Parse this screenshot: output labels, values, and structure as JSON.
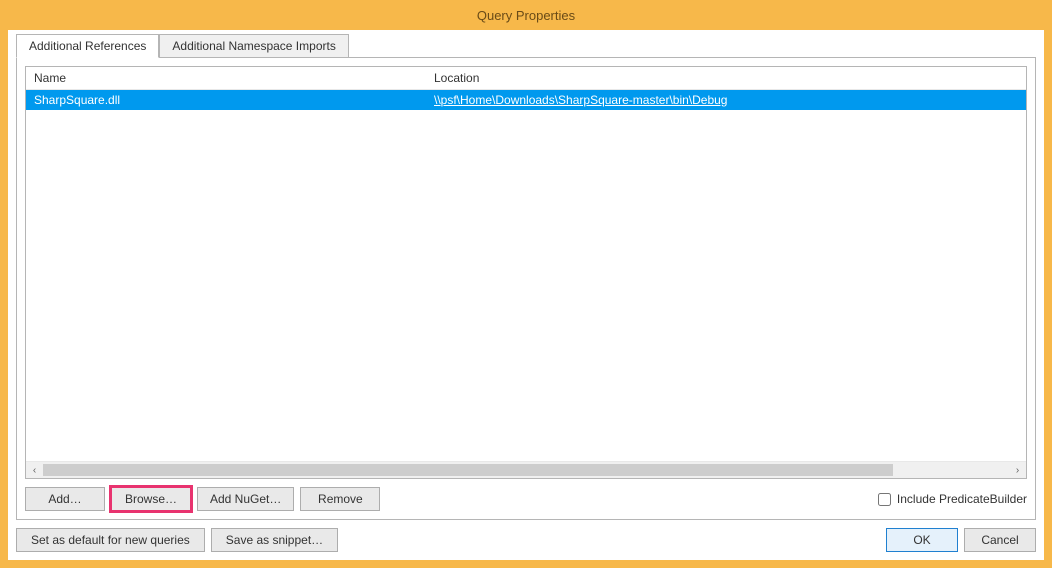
{
  "window": {
    "title": "Query Properties"
  },
  "tabs": {
    "items": [
      {
        "label": "Additional References",
        "active": true
      },
      {
        "label": "Additional Namespace Imports",
        "active": false
      }
    ]
  },
  "grid": {
    "columns": {
      "name": "Name",
      "location": "Location"
    },
    "rows": [
      {
        "name": "SharpSquare.dll",
        "location": "\\\\psf\\Home\\Downloads\\SharpSquare-master\\bin\\Debug"
      }
    ]
  },
  "toolbar": {
    "add": "Add…",
    "browse": "Browse…",
    "addNuGet": "Add NuGet…",
    "remove": "Remove",
    "includePredicateBuilder": "Include PredicateBuilder"
  },
  "bottom": {
    "setDefault": "Set as default for new queries",
    "saveSnippet": "Save as snippet…",
    "ok": "OK",
    "cancel": "Cancel"
  }
}
